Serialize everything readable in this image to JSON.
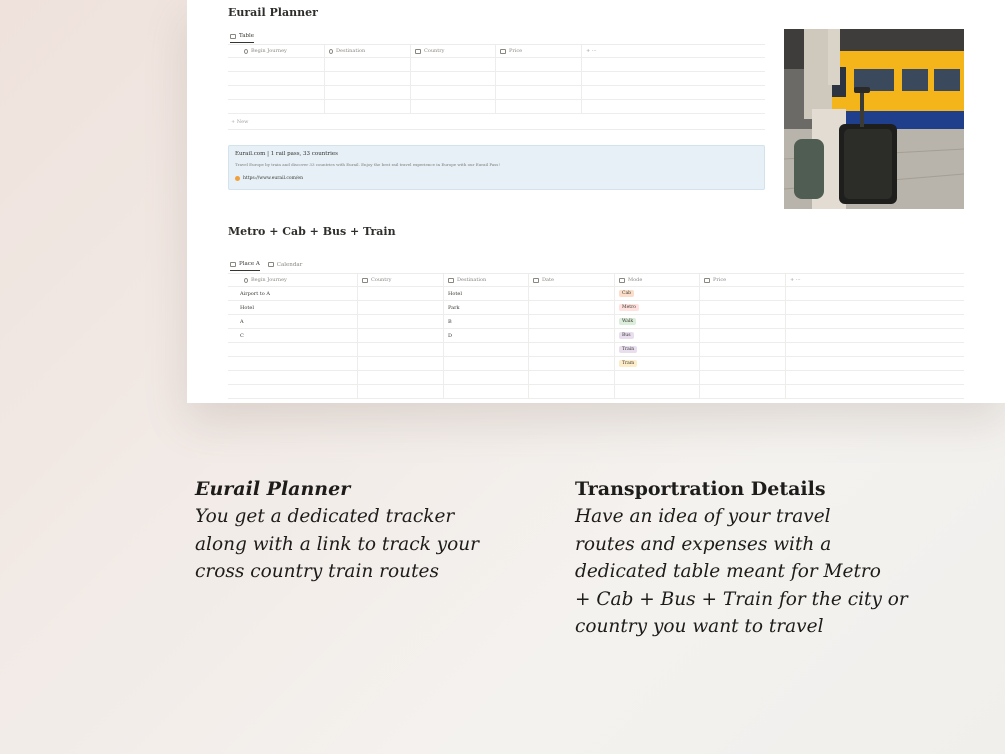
{
  "sheet": {
    "section1_title": "Eurail Planner",
    "section1_tabs": [
      {
        "label": "Table"
      }
    ],
    "table1": {
      "columns": [
        "Begin Journey",
        "Destination",
        "Country",
        "Price"
      ],
      "add_label": "+ ···",
      "new_label": "+ New"
    },
    "bookmark": {
      "title": "Eurail.com | 1 rail pass, 33 countries",
      "description": "Travel Europe by train and discover 33 countries with Eurail. Enjoy the best rail travel experience in Europe with our Eurail Pass!",
      "url": "https://www.eurail.com/en"
    },
    "section2_title": "Metro + Cab + Bus + Train",
    "section2_tabs": [
      {
        "label": "Place A"
      },
      {
        "label": "Calendar"
      }
    ],
    "table2": {
      "columns": [
        "Begin Journey",
        "Country",
        "Destination",
        "Date",
        "Mode",
        "Price"
      ],
      "add_label": "+ ···",
      "rows": [
        {
          "begin": "Airport to A",
          "country": "",
          "destination": "Hotel",
          "date": "",
          "mode": "Cab",
          "mode_bg": "#fadec9",
          "price": ""
        },
        {
          "begin": "Hotel",
          "country": "",
          "destination": "Park",
          "date": "",
          "mode": "Metro",
          "mode_bg": "#ffe2dd",
          "price": ""
        },
        {
          "begin": "A",
          "country": "",
          "destination": "B",
          "date": "",
          "mode": "Walk",
          "mode_bg": "#dbeddb",
          "price": ""
        },
        {
          "begin": "C",
          "country": "",
          "destination": "D",
          "date": "",
          "mode": "Bus",
          "mode_bg": "#e8deee",
          "price": ""
        },
        {
          "begin": "",
          "country": "",
          "destination": "",
          "date": "",
          "mode": "Train",
          "mode_bg": "#e8deee",
          "price": ""
        },
        {
          "begin": "",
          "country": "",
          "destination": "",
          "date": "",
          "mode": "Tram",
          "mode_bg": "#fdecc8",
          "price": ""
        }
      ]
    }
  },
  "captions": {
    "left": {
      "title": "Eurail Planner",
      "lines": [
        "You get a dedicated tracker",
        "along with a link to track your",
        "cross country train routes"
      ]
    },
    "right": {
      "title": "Transportration Details",
      "lines": [
        "Have an idea of your travel",
        "routes and expenses with a",
        "dedicated table meant for Metro",
        "+ Cab + Bus + Train for the city or",
        "country you want to travel"
      ]
    }
  },
  "colors": {
    "accent_text": "#37352f",
    "muted_text": "#8a8780",
    "bookmark_bg": "#e6f0f6",
    "train_yellow": "#f3b51a",
    "train_blue": "#1f3e8c"
  }
}
